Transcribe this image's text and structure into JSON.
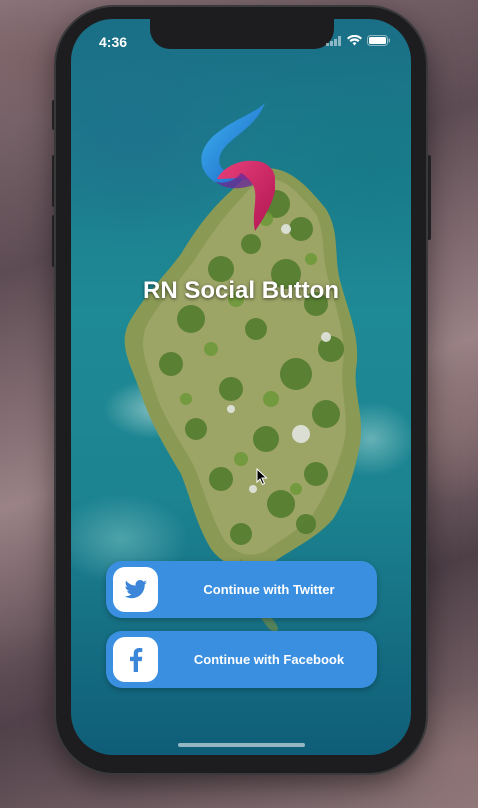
{
  "status_bar": {
    "time": "4:36"
  },
  "app": {
    "title": "RN Social Button"
  },
  "buttons": {
    "twitter_label": "Continue with Twitter",
    "facebook_label": "Continue with Facebook"
  },
  "colors": {
    "button_bg": "#3a8fe0",
    "icon_blue": "#3b86d8"
  },
  "icons": {
    "twitter": "twitter-bird-icon",
    "facebook": "facebook-f-icon",
    "logo": "app-logo"
  }
}
